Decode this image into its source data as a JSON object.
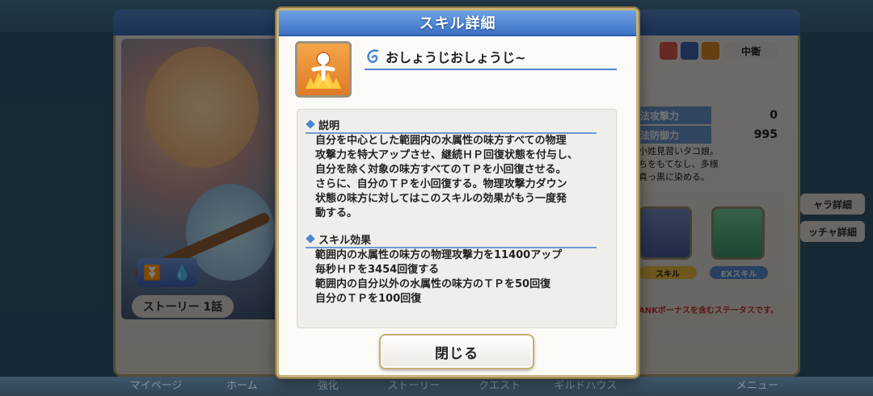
{
  "modal": {
    "title": "スキル詳細",
    "skill_name": "おしょうじおしょうじ~",
    "close_label": "閉じる",
    "sections": {
      "description": {
        "heading": "説明",
        "lines": [
          "自分を中心とした範囲内の水属性の味方すべての物理",
          "攻撃力を特大アップさせ、継続ＨＰ回復状態を付与し、",
          "自分を除く対象の味方すべてのＴＰを小回復させる。",
          "さらに、自分のＴＰを小回復する。物理攻撃力ダウン",
          "状態の味方に対してはこのスキルの効果がもう一度発",
          "動する。"
        ]
      },
      "effect": {
        "heading": "スキル効果",
        "lines": [
          "範囲内の水属性の味方の物理攻撃力を11400アップ",
          "毎秒ＨＰを3454回復する",
          "範囲内の自分以外の水属性の味方のＴＰを50回復",
          "自分のＴＰを100回復"
        ]
      }
    },
    "colors": {
      "header": "#3d72c6",
      "accent": "#4b86cf",
      "gold_border": "#c8b27a",
      "icon_bg": "#e07a26"
    }
  },
  "background": {
    "story_button": "ストーリー 1話",
    "position_label": "中衛",
    "stats": [
      {
        "label": "法攻撃力",
        "value": "0"
      },
      {
        "label": "法防御力",
        "value": "995"
      }
    ],
    "profile_lines": [
      "小姓見習いタコ娘。",
      "ちをもてなし、多様",
      "真っ黒に染める。"
    ],
    "skill_tags": [
      "スキル",
      "EXスキル"
    ],
    "rank_note": "ANKボーナスを含むステータスです。",
    "side_buttons": [
      "ャラ詳細",
      "ッチャ詳細"
    ],
    "bottom_tabs": [
      "マイページ",
      "ホーム",
      "強化",
      "ストーリー",
      "クエスト",
      "ギルドハウス",
      "",
      "メニュー"
    ]
  }
}
